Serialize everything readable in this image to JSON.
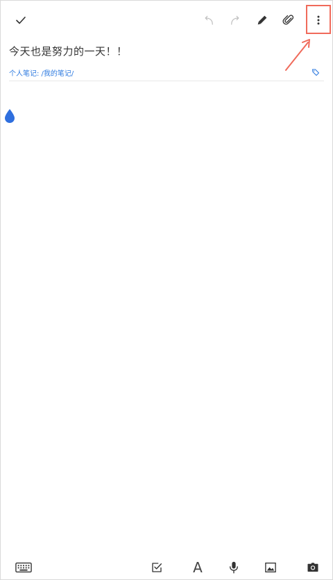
{
  "toolbar": {
    "done": "done-check-icon",
    "undo": "undo-icon",
    "redo": "redo-icon",
    "pen": "pen-icon",
    "attach": "paperclip-icon",
    "more": "more-vert-icon"
  },
  "note": {
    "title": "今天也是努力的一天！！",
    "path": "个人笔记: /我的笔记/"
  },
  "bottom_bar": {
    "keyboard": "keyboard-icon",
    "checkbox": "checkbox-icon",
    "text_format_glyph": "A",
    "mic": "mic-icon",
    "image": "image-icon",
    "camera": "camera-icon"
  },
  "colors": {
    "accent": "#2f7be0",
    "highlight": "#f06a5a",
    "icon": "#333333",
    "icon_disabled": "#bdbdbd"
  }
}
